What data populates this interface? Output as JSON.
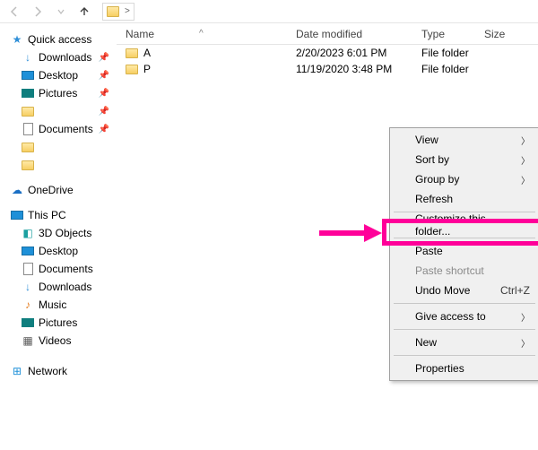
{
  "toolbar": {
    "address_caret": ">"
  },
  "columns": {
    "name": "Name",
    "sort_caret": "^",
    "date": "Date modified",
    "type": "Type",
    "size": "Size"
  },
  "rows": [
    {
      "name": "A",
      "date": "2/20/2023 6:01 PM",
      "type": "File folder"
    },
    {
      "name": "P",
      "date": "11/19/2020 3:48 PM",
      "type": "File folder"
    }
  ],
  "sidebar": {
    "quick": {
      "label": "Quick access",
      "items": [
        {
          "label": "Downloads",
          "pinned": true
        },
        {
          "label": "Desktop",
          "pinned": true
        },
        {
          "label": "Pictures",
          "pinned": true
        }
      ],
      "extra": [
        {
          "label": "",
          "pinned": true
        },
        {
          "label": "Documents",
          "pinned": true
        },
        {
          "label": "",
          "pinned": false
        },
        {
          "label": "",
          "pinned": false
        }
      ]
    },
    "onedrive": {
      "label": "OneDrive"
    },
    "thispc": {
      "label": "This PC",
      "items": [
        {
          "label": "3D Objects"
        },
        {
          "label": "Desktop"
        },
        {
          "label": "Documents"
        },
        {
          "label": "Downloads"
        },
        {
          "label": "Music"
        },
        {
          "label": "Pictures"
        },
        {
          "label": "Videos"
        }
      ]
    },
    "network": {
      "label": "Network"
    }
  },
  "context_menu": {
    "view": "View",
    "sort_by": "Sort by",
    "group_by": "Group by",
    "refresh": "Refresh",
    "customize": "Customize this folder...",
    "paste": "Paste",
    "paste_sc": "Paste shortcut",
    "undo": "Undo Move",
    "undo_sc": "Ctrl+Z",
    "give_access": "Give access to",
    "new": "New",
    "properties": "Properties"
  }
}
